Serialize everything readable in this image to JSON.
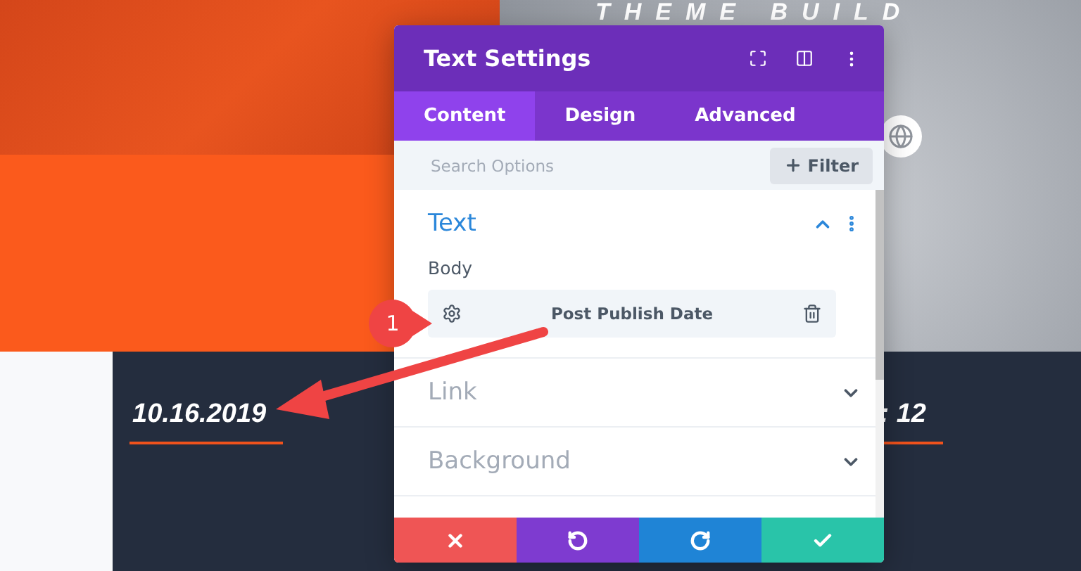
{
  "hero": {
    "title": "THEME BUILD"
  },
  "post_meta": [
    {
      "text": "10.16.2019"
    },
    {
      "text": ": 12"
    }
  ],
  "modal": {
    "title": "Text Settings",
    "tabs": [
      {
        "label": "Content",
        "selected": true
      },
      {
        "label": "Design",
        "selected": false
      },
      {
        "label": "Advanced",
        "selected": false
      }
    ],
    "search": {
      "placeholder": "Search Options"
    },
    "filter_button": {
      "label": "Filter"
    },
    "sections": [
      {
        "title": "Text",
        "expanded": true,
        "fields": [
          {
            "label": "Body",
            "value": "Post Publish Date"
          }
        ]
      },
      {
        "title": "Link",
        "expanded": false
      },
      {
        "title": "Background",
        "expanded": false
      }
    ],
    "footer_buttons": [
      {
        "kind": "cancel"
      },
      {
        "kind": "undo"
      },
      {
        "kind": "redo"
      },
      {
        "kind": "save"
      }
    ]
  },
  "annotation": {
    "badge": "1"
  }
}
